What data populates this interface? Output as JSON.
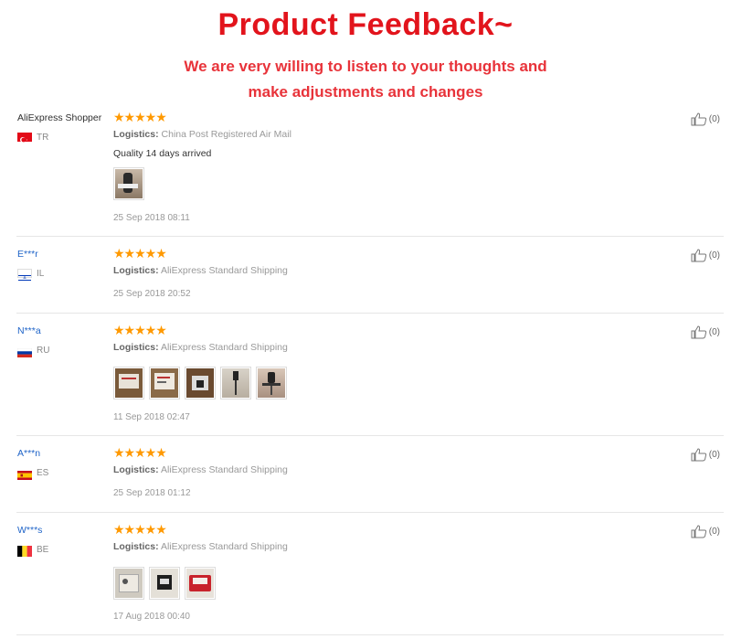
{
  "header": {
    "title": "Product Feedback~",
    "subtitle_line1": "We are very willing to listen to your thoughts and",
    "subtitle_line2": "make adjustments and changes"
  },
  "colors": {
    "title": "#e2141c",
    "star": "#ff9900",
    "masked_name": "#1f64c8"
  },
  "reviews": [
    {
      "user": "AliExpress Shopper",
      "country": "TR",
      "flag": "turkey-flag",
      "stars": "★★★★★",
      "rating": 5,
      "logistics_label": "Logistics:",
      "logistics_value": "China Post Registered Air Mail",
      "comment": "Quality 14 days arrived",
      "photos": 1,
      "date": "25 Sep 2018 08:11",
      "likes": "(0)"
    },
    {
      "user": "E***r",
      "country": "IL",
      "flag": "israel-flag",
      "stars": "★★★★★",
      "rating": 5,
      "logistics_label": "Logistics:",
      "logistics_value": "AliExpress Standard Shipping",
      "comment": "",
      "photos": 0,
      "date": "25 Sep 2018 20:52",
      "likes": "(0)"
    },
    {
      "user": "N***a",
      "country": "RU",
      "flag": "russia-flag",
      "stars": "★★★★★",
      "rating": 5,
      "logistics_label": "Logistics:",
      "logistics_value": "AliExpress Standard Shipping",
      "comment": "",
      "photos": 5,
      "date": "11 Sep 2018 02:47",
      "likes": "(0)"
    },
    {
      "user": "A***n",
      "country": "ES",
      "flag": "spain-flag",
      "stars": "★★★★★",
      "rating": 5,
      "logistics_label": "Logistics:",
      "logistics_value": "AliExpress Standard Shipping",
      "comment": "",
      "photos": 0,
      "date": "25 Sep 2018 01:12",
      "likes": "(0)"
    },
    {
      "user": "W***s",
      "country": "BE",
      "flag": "belgium-flag",
      "stars": "★★★★★",
      "rating": 5,
      "logistics_label": "Logistics:",
      "logistics_value": "AliExpress Standard Shipping",
      "comment": "",
      "photos": 3,
      "date": "17 Aug 2018 00:40",
      "likes": "(0)"
    }
  ]
}
